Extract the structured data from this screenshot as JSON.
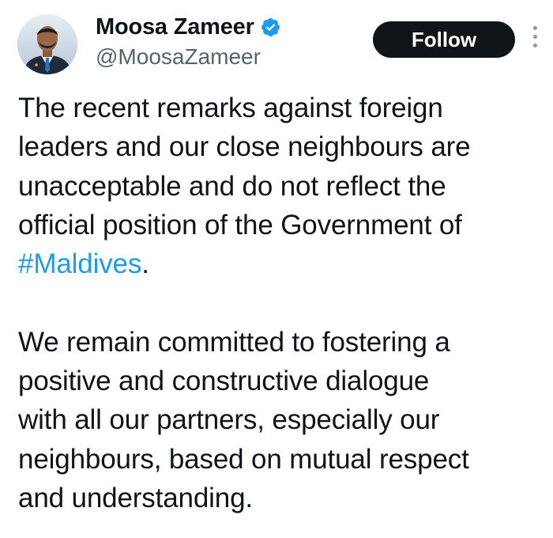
{
  "author": {
    "display_name": "Moosa Zameer",
    "handle": "@MoosaZameer",
    "verified": true,
    "avatar_icon": "profile-photo"
  },
  "actions": {
    "follow_label": "Follow",
    "more_icon": "ellipsis-vertical-icon"
  },
  "tweet": {
    "paragraph1": {
      "line1": "The recent remarks against foreign",
      "line2": "leaders and our close neighbours are",
      "line3": "unacceptable and do not reflect the",
      "line4": "official position of the Government of",
      "hashtag": "#Maldives",
      "trailing": "."
    },
    "paragraph2": {
      "line1": "We remain committed to fostering a",
      "line2": "positive and constructive dialogue",
      "line3": "with all our partners, especially our",
      "line4": "neighbours, based on mutual respect",
      "line5": "and understanding."
    }
  },
  "colors": {
    "text": "#0f1419",
    "handle": "#536471",
    "link": "#1d9bf0",
    "verified_badge": "#1d9bf0",
    "follow_bg": "#0f1419",
    "follow_text": "#ffffff"
  }
}
